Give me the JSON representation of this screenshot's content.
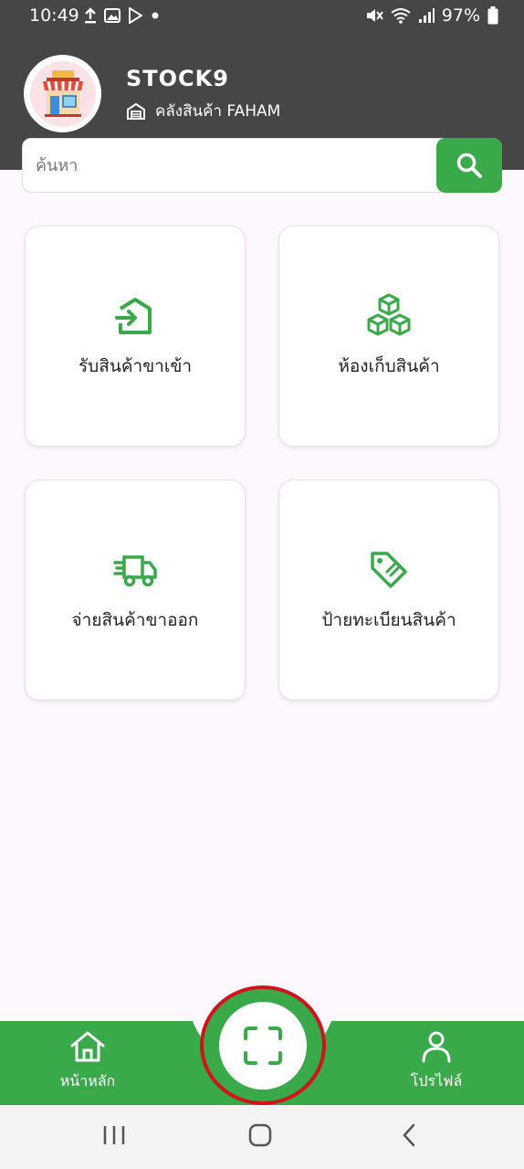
{
  "status_bar": {
    "time": "10:49",
    "battery": "97%"
  },
  "header": {
    "app_title": "STOCK9",
    "warehouse_name": "คลังสินค้า FAHAM"
  },
  "search": {
    "placeholder": "ค้นหา"
  },
  "menu": [
    {
      "label": "รับสินค้าขาเข้า",
      "icon": "receive-in-icon"
    },
    {
      "label": "ห้องเก็บสินค้า",
      "icon": "boxes-icon"
    },
    {
      "label": "จ่ายสินค้าขาออก",
      "icon": "delivery-truck-icon"
    },
    {
      "label": "ป้ายทะเบียนสินค้า",
      "icon": "price-tag-icon"
    }
  ],
  "bottom_nav": {
    "home_label": "หน้าหลัก",
    "profile_label": "โปรไฟล์"
  },
  "colors": {
    "accent": "#3aa94a",
    "header_bg": "#464646",
    "highlight_ring": "#d0141e"
  }
}
